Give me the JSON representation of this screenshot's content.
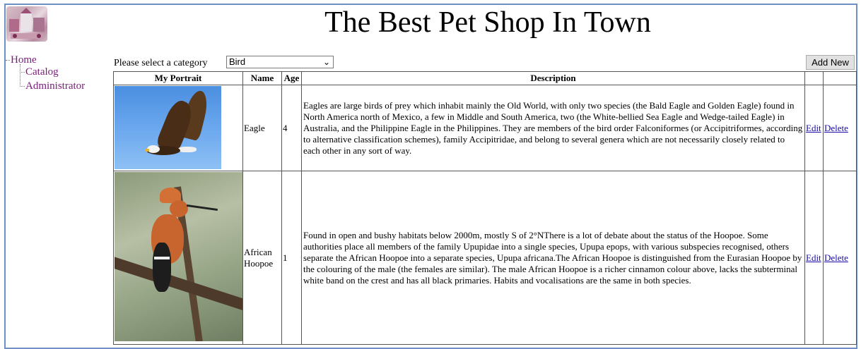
{
  "header": {
    "title": "The Best Pet Shop In Town"
  },
  "nav": {
    "items": [
      {
        "label": "Home"
      },
      {
        "label": "Catalog"
      },
      {
        "label": "Administrator"
      }
    ]
  },
  "filter": {
    "label": "Please select a category",
    "selected": "Bird"
  },
  "toolbar": {
    "add_label": "Add New"
  },
  "table": {
    "headers": [
      "My Portrait",
      "Name",
      "Age",
      "Description"
    ],
    "rows": [
      {
        "name": "Eagle",
        "age": "4",
        "description": "Eagles are large birds of prey which inhabit mainly the Old World, with only two species (the Bald Eagle and Golden Eagle) found in North America north of Mexico, a few in Middle and South America, two (the White-bellied Sea Eagle and Wedge-tailed Eagle) in Australia, and the Philippine Eagle in the Philippines. They are members of the bird order Falconiformes (or Accipitriformes, according to alternative classification schemes), family Accipitridae, and belong to several genera which are not necessarily closely related to each other in any sort of way.",
        "edit": "Edit",
        "delete": "Delete"
      },
      {
        "name": "African Hoopoe",
        "age": "1",
        "description": "Found in open and bushy habitats below 2000m, mostly S of 2°NThere is a lot of debate about the status of the Hoopoe. Some authorities place all members of the family Upupidae into a single species, Upupa epops, with various subspecies recognised, others separate the African Hoopoe into a separate species, Upupa africana.The African Hoopoe is distinguished from the Eurasian Hoopoe by the colouring of the male (the females are similar). The male African Hoopoe is a richer cinnamon colour above, lacks the subterminal white band on the crest and has all black primaries. Habits and vocalisations are the same in both species.",
        "edit": "Edit",
        "delete": "Delete"
      }
    ]
  },
  "colors": {
    "frame": "#6f8fc7",
    "nav_link": "#7a1a7a",
    "table_link": "#1a0dab"
  }
}
